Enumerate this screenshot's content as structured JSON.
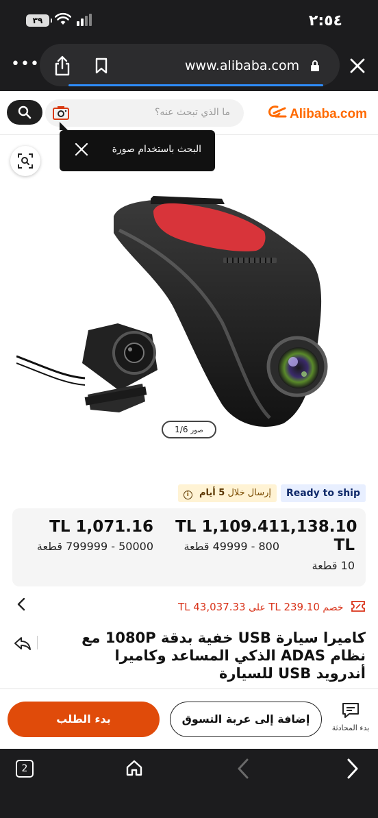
{
  "status_bar": {
    "time": "٢:٥٤",
    "battery": "٣٩"
  },
  "browser": {
    "url": "www.alibaba.com",
    "tabs_count": "2"
  },
  "site": {
    "logo_text": "Alibaba.com",
    "search_placeholder": "ما الذي تبحث عنه؟",
    "image_search_tooltip": "البحث باستخدام صورة"
  },
  "gallery": {
    "counter": "1/6",
    "counter_label": "صور"
  },
  "shipping": {
    "ready_label": "Ready to ship",
    "delivery_prefix": "إرسال خلال",
    "delivery_days": "5 أيام"
  },
  "price_tiers": [
    {
      "price": "1,138.10 TL",
      "qty": "10 قطعة"
    },
    {
      "price": "TL 1,109.41",
      "qty": "800 - 49999 قطعة"
    },
    {
      "price": "TL 1,071.16",
      "qty": "50000 - 799999 قطعة"
    }
  ],
  "discount": {
    "label": "خصم",
    "amount": "TL 239.10",
    "on": "على",
    "threshold": "TL 43,037.33"
  },
  "product": {
    "title": "كاميرا سيارة USB خفية بدقة 1080P مع نظام ADAS الذكي المساعد وكاميرا أندرويد USB للسيارة"
  },
  "actions": {
    "chat_label": "بدء المحادثة",
    "cart_label": "إضافة إلى عربة التسوق",
    "order_label": "بدء الطلب"
  },
  "colors": {
    "brand_orange": "#ff6a00",
    "order_button": "#e04b0a",
    "discount_red": "#d9331a",
    "ready_badge_bg": "#e8efff",
    "delivery_badge_bg": "#fff3d4"
  },
  "icons": [
    "share-icon",
    "bookmark-icon",
    "lock-icon",
    "close-icon",
    "search-icon",
    "camera-icon",
    "visual-search-icon",
    "chevron-left-icon",
    "coupon-icon",
    "share-product-icon",
    "chat-icon",
    "home-icon",
    "back-arrow-icon",
    "forward-arrow-icon"
  ]
}
